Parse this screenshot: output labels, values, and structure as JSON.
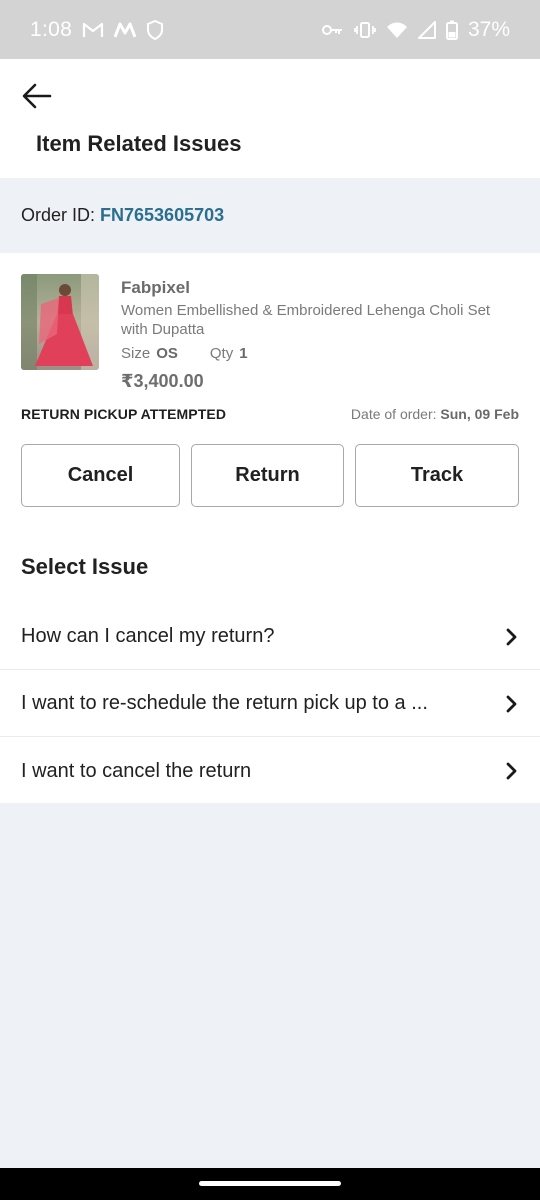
{
  "status_bar": {
    "time": "1:08",
    "battery": "37%",
    "icons": [
      "gmail-icon",
      "myntra-icon",
      "shield-icon",
      "key-icon",
      "vibrate-icon",
      "wifi-icon",
      "signal-icon",
      "battery-icon"
    ]
  },
  "header": {
    "title": "Item Related Issues",
    "back_icon": "arrow-left-icon"
  },
  "order": {
    "label": "Order ID:",
    "id": "FN7653605703"
  },
  "product": {
    "brand": "Fabpixel",
    "name": "Women Embellished & Embroidered Lehenga Choli Set with Dupatta",
    "size_label": "Size",
    "size": "OS",
    "qty_label": "Qty",
    "qty": "1",
    "price": "₹3,400.00",
    "status": "RETURN PICKUP ATTEMPTED",
    "date_label": "Date of order:",
    "date": "Sun, 09 Feb"
  },
  "actions": {
    "cancel": "Cancel",
    "return": "Return",
    "track": "Track"
  },
  "issues": {
    "title": "Select Issue",
    "items": [
      "How can I cancel my return?",
      "I want to re-schedule the return pick up to a ...",
      "I want to cancel the return"
    ]
  },
  "colors": {
    "accent": "#2a6f8f",
    "background": "#eef1f5",
    "status_bar": "#d3d3d3"
  }
}
